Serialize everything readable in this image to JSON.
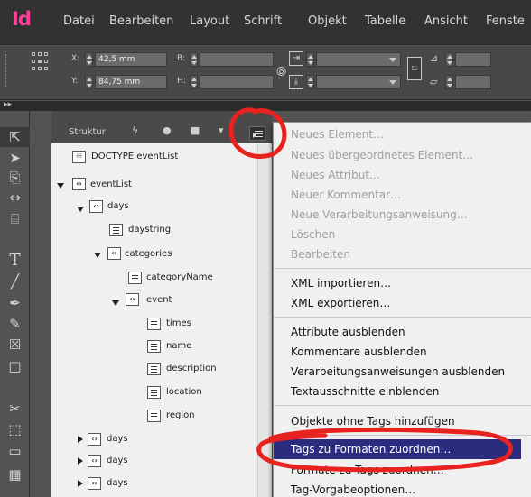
{
  "app": {
    "logo": "Id",
    "menu": [
      "Datei",
      "Bearbeiten",
      "Layout",
      "Schrift",
      "Objekt",
      "Tabelle",
      "Ansicht",
      "Fenste"
    ]
  },
  "control_bar": {
    "x_label": "X:",
    "x_value": "42,5 mm",
    "y_label": "Y:",
    "y_value": "84,75 mm",
    "w_label": "B:",
    "h_label": "H:"
  },
  "tools": [
    "selection-tool",
    "direct-selection-tool",
    "page-tool",
    "gap-tool",
    "content-collector-tool",
    "type-tool",
    "line-tool",
    "pen-tool",
    "pencil-tool",
    "rectangle-frame-tool",
    "rectangle-tool",
    "scissors-tool",
    "free-transform-tool",
    "gradient-swatch-tool",
    "gradient-feather-tool"
  ],
  "structure_panel": {
    "title": "Struktur",
    "tree": [
      {
        "label": "DOCTYPE eventList",
        "type": "doctype"
      },
      {
        "label": "eventList",
        "type": "element",
        "expanded": true
      },
      {
        "label": "days",
        "type": "element",
        "expanded": true
      },
      {
        "label": "daystring",
        "type": "text"
      },
      {
        "label": "categories",
        "type": "element",
        "expanded": true
      },
      {
        "label": "categoryName",
        "type": "text"
      },
      {
        "label": "event",
        "type": "element",
        "expanded": true
      },
      {
        "label": "times",
        "type": "text"
      },
      {
        "label": "name",
        "type": "text"
      },
      {
        "label": "description",
        "type": "text"
      },
      {
        "label": "location",
        "type": "text"
      },
      {
        "label": "region",
        "type": "text"
      },
      {
        "label": "days",
        "type": "element",
        "expanded": false
      },
      {
        "label": "days",
        "type": "element",
        "expanded": false
      },
      {
        "label": "days",
        "type": "element",
        "expanded": false
      }
    ]
  },
  "flyout_menu": {
    "group1": [
      "Neues Element…",
      "Neues übergeordnetes Element…",
      "Neues Attribut…",
      "Neuer Kommentar…",
      "Neue Verarbeitungsanweisung…",
      "Löschen",
      "Bearbeiten"
    ],
    "group2": [
      "XML importieren…",
      "XML exportieren…"
    ],
    "group3": [
      "Attribute ausblenden",
      "Kommentare ausblenden",
      "Verarbeitungsanweisungen ausblenden",
      "Textausschnitte einblenden"
    ],
    "group4_first": "Objekte ohne Tags hinzufügen",
    "highlighted": "Tags zu Formaten zuordnen…",
    "after_highlight": "Formate zu Tags zuordnen…",
    "last": "Tag-Vorgabeoptionen…"
  },
  "colors": {
    "logo": "#ff3f98",
    "highlight": "#2c2c7e",
    "annotation": "#e8231f"
  }
}
